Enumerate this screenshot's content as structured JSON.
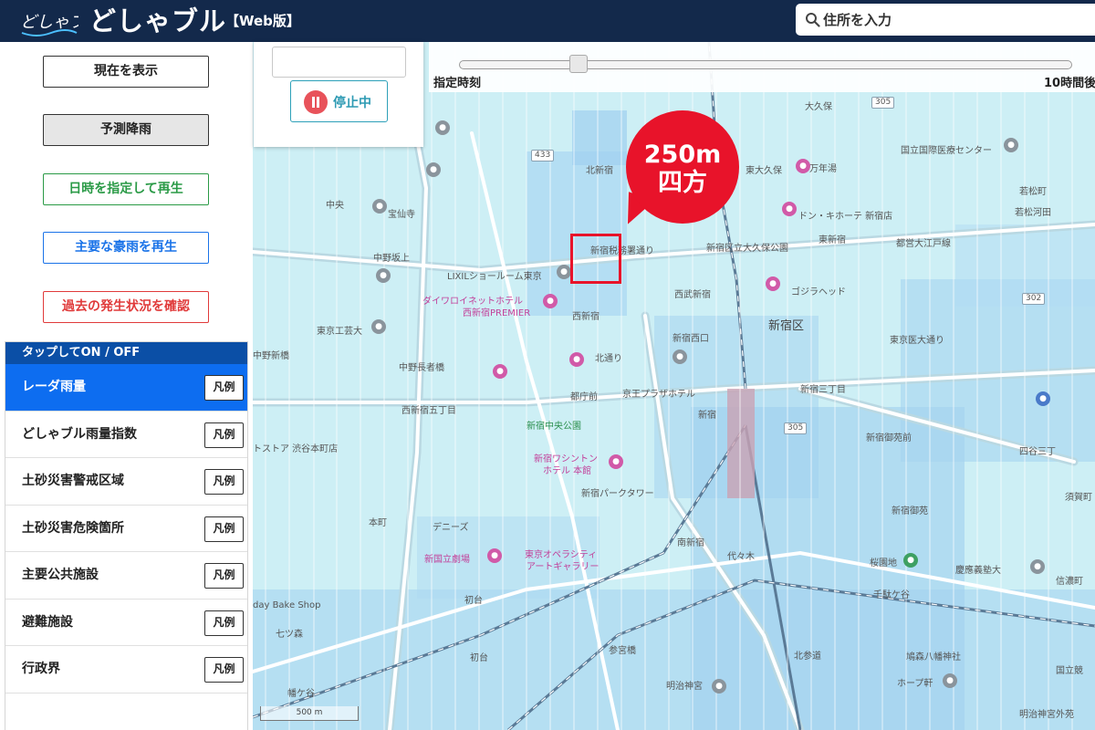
{
  "header": {
    "logo_text": "どしゃブル",
    "title": "どしゃブル",
    "subtitle": "【Web版】",
    "search_placeholder": "住所を入力",
    "search_icon": "search-icon"
  },
  "sidebar": {
    "buttons": {
      "now": "現在を表示",
      "forecast": "予測降雨",
      "date": "日時を指定して再生",
      "heavy": "主要な豪雨を再生",
      "past": "過去の発生状況を確認"
    },
    "layers_header": "タップしてON / OFF",
    "legend_label": "凡例",
    "layers": [
      {
        "label": "レーダ雨量",
        "active": true
      },
      {
        "label": "どしゃブル雨量指数",
        "active": false
      },
      {
        "label": "土砂災害警戒区域",
        "active": false
      },
      {
        "label": "土砂災害危険箇所",
        "active": false
      },
      {
        "label": "主要公共施設",
        "active": false
      },
      {
        "label": "避難施設",
        "active": false
      },
      {
        "label": "行政界",
        "active": false
      }
    ]
  },
  "controls": {
    "pause_label": "停止中",
    "slider_start": "指定時刻",
    "slider_end": "10時間後",
    "slider_position": 0.2
  },
  "callout": {
    "line1": "250m",
    "line2": "四方"
  },
  "map": {
    "scale_label": "500 m",
    "labels": {
      "okubo": "大久保",
      "ncgm": "国立国際医療センター",
      "wakamatsu": "若松町",
      "kitashinjuku": "北新宿",
      "higashiokubo": "東大久保",
      "manjuyu": "万年湯",
      "wakamatsukawada": "若松河田",
      "chuo": "中央",
      "hosenin": "宝仙寺",
      "donki": "ドン・キホーテ 新宿店",
      "nakano_sakaue": "中野坂上",
      "zeimusho": "新宿税務署通り",
      "okubo_park": "新宿区立大久保公園",
      "higashishinjuku": "東新宿",
      "toeioedo": "都営大江戸線",
      "lixil": "LIXILショールーム東京",
      "daiwa1": "ダイワロイネットホテル",
      "daiwa2": "西新宿PREMIER",
      "seibushinjuku": "西武新宿",
      "godzilla": "ゴジラヘッド",
      "tokyokogei": "東京工芸大",
      "nishishinjuku": "西新宿",
      "shinjukuku": "新宿区",
      "nishishinjuku7": "新宿西口",
      "higashishinjuku_odori": "東京医大通り",
      "nakano_shinbashi": "中野新橋",
      "kitadori": "北通り",
      "nakanonagasaki": "中野長者橋",
      "tochomae": "都庁前",
      "keioplaza": "京王プラザホテル",
      "shinjukusanchome": "新宿三丁目",
      "nishishinjukugochome": "西新宿五丁目",
      "chuo_park": "新宿中央公園",
      "shinjuku": "新宿",
      "shibuya_store": "トストア 渋谷本町店",
      "washington1": "新宿ワシントン",
      "washington2": "ホテル 本館",
      "gyoenmae": "新宿御苑前",
      "yotsuya": "四谷三丁",
      "park_tower": "新宿パークタワー",
      "gyoen": "新宿御苑",
      "sugacho": "須賀町",
      "honmachi": "本町",
      "dennys": "デニーズ",
      "operacity1": "東京オペラシティ",
      "operacity2": "アートギャラリー",
      "minamishinjuku": "南新宿",
      "yoyogi": "代々木",
      "sakuraike": "桜園地",
      "keio_hospital": "慶應義塾大",
      "shinanomachi": "信濃町",
      "newtheater": "新国立劇場",
      "bakeshop": "day Bake Shop",
      "hatsudai": "初台",
      "sendagaya": "千駄ケ谷",
      "shibuyakuritsu": "七ツ森",
      "hatagaya": "幡ケ谷",
      "sangubashi": "参宮橋",
      "kitasando": "北参道",
      "hatomori": "鳩森八幡神社",
      "hopeken": "ホープ軒",
      "meiji": "明治神宮",
      "kokuritsu": "国立競",
      "hatsudai2": "初台",
      "meijijingumae": "明治神宮外苑"
    }
  }
}
